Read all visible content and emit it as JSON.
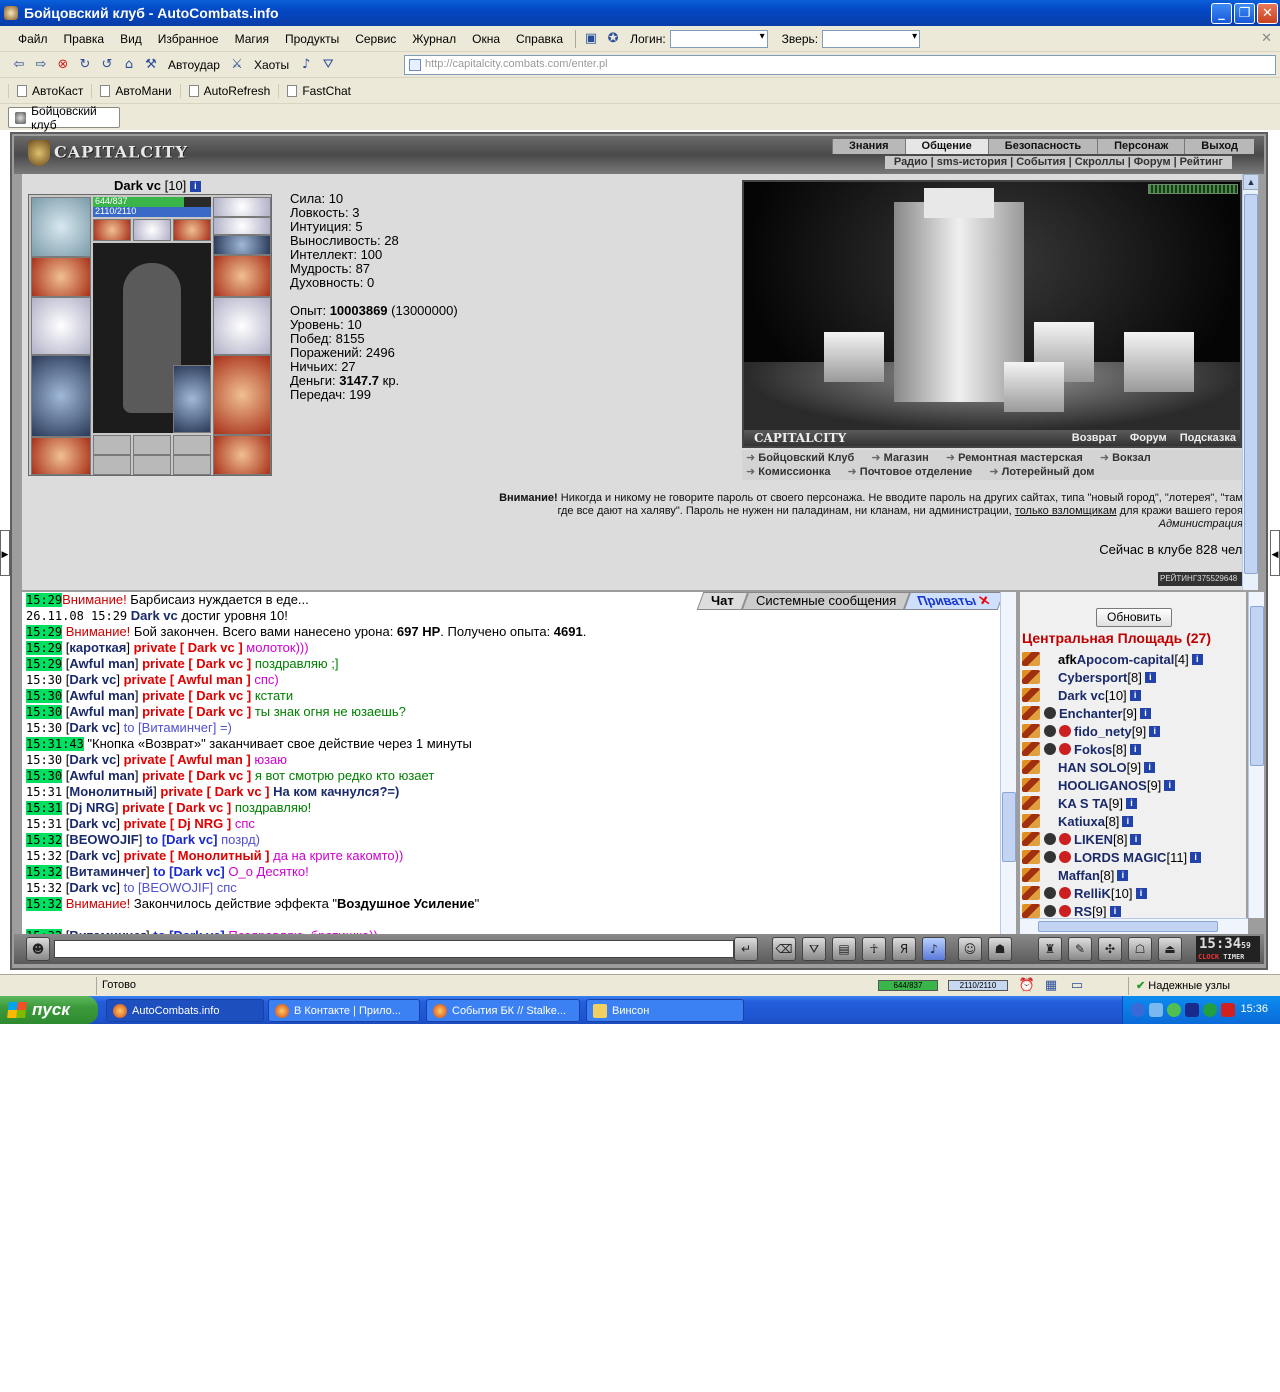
{
  "window": {
    "title": "Бойцовский клуб - AutoCombats.info",
    "min": "_",
    "max": "❐",
    "close": "✕"
  },
  "menu": {
    "items": [
      "Файл",
      "Правка",
      "Вид",
      "Избранное",
      "Магия",
      "Продукты",
      "Сервис",
      "Журнал",
      "Окна",
      "Справка"
    ],
    "login_label": "Логин:",
    "beast_label": "Зверь:",
    "login_value": "",
    "beast_value": ""
  },
  "nav": {
    "autoudar": "Автоудар",
    "haoty": "Хаоты",
    "url": "http://capitalcity.combats.com/enter.pl"
  },
  "favorites": [
    "АвтоКаст",
    "АвтоМани",
    "AutoRefresh",
    "FastChat"
  ],
  "tab": {
    "label": "Бойцовский клуб"
  },
  "game": {
    "logo": "CAPITALCITY",
    "top_nav": [
      "Знания",
      "Общение",
      "Безопасность",
      "Персонаж",
      "Выход"
    ],
    "top_nav_active": "Общение",
    "sub_nav": [
      "Радио",
      "sms-история",
      "События",
      "Скроллы",
      "Форум",
      "Рейтинг"
    ],
    "char": {
      "name": "Dark vc",
      "level": "[10]",
      "hp": "644/837",
      "hp_fraction": 0.77,
      "mp": "2110/2110",
      "mp_fraction": 1.0
    },
    "stats": [
      {
        "label": "Сила:",
        "value": "10"
      },
      {
        "label": "Ловкость:",
        "value": "3"
      },
      {
        "label": "Интуиция:",
        "value": "5"
      },
      {
        "label": "Выносливость:",
        "value": "28"
      },
      {
        "label": "Интеллект:",
        "value": "100"
      },
      {
        "label": "Мудрость:",
        "value": "87"
      },
      {
        "label": "Духовность:",
        "value": "0"
      }
    ],
    "exp_label": "Опыт:",
    "exp_value": "10003869",
    "exp_next": "(13000000)",
    "level_label": "Уровень:",
    "level_value": "10",
    "wins_label": "Побед:",
    "wins_value": "8155",
    "losses_label": "Поражений:",
    "losses_value": "2496",
    "draws_label": "Ничьих:",
    "draws_value": "27",
    "money_label": "Деньги:",
    "money_value": "3147.7",
    "money_unit": "кр.",
    "transfers_label": "Передач:",
    "transfers_value": "199",
    "city_name": "CAPITALCITY",
    "city_bar_links": [
      "Возврат",
      "Форум",
      "Подсказка"
    ],
    "city_links": [
      "Бойцовский Клуб",
      "Магазин",
      "Ремонтная мастерская",
      "Вокзал",
      "Комиссионка",
      "Почтовое отделение",
      "Лотерейный дом"
    ],
    "warning_bold": "Внимание!",
    "warning_text": "Никогда и никому не говорите пароль от своего персонажа. Не вводите пароль на других сайтах, типа \"новый город\", \"лотерея\", \"там, где все дают на халяву\". Пароль не нужен ни паладинам, ни кланам, ни администрации,",
    "warning_link": "только взломщикам",
    "warning_tail": "для кражи вашего героя.",
    "warning_sign": "Администрация.",
    "online": "Сейчас в клубе 828 чел.",
    "rating": "РЕЙТИНГ375529648"
  },
  "chat": {
    "tabs": [
      "Чат",
      "Системные сообщения",
      "Приваты"
    ],
    "lines": [
      {
        "t": "15:29",
        "g": true,
        "parts": [
          {
            "c": "sys",
            "x": "Внимание!"
          },
          {
            "c": "",
            "x": " Барбисаиз нуждается в еде..."
          }
        ]
      },
      {
        "t": "26.11.08 15:29",
        "g": false,
        "parts": [
          {
            "c": "nick",
            "x": " Dark vc"
          },
          {
            "c": "",
            "x": " достиг уровня 10!"
          }
        ]
      },
      {
        "t": "15:29",
        "g": true,
        "parts": [
          {
            "c": "sys",
            "x": " Внимание!"
          },
          {
            "c": "",
            "x": " Бой закончен. Всего вами нанесено урона: "
          },
          {
            "c": "b",
            "x": "697 HP"
          },
          {
            "c": "",
            "x": ". Получено опыта: "
          },
          {
            "c": "b",
            "x": "4691"
          },
          {
            "c": "",
            "x": "."
          }
        ]
      },
      {
        "t": "15:29",
        "g": true,
        "parts": [
          {
            "c": "",
            "x": " ["
          },
          {
            "c": "nick",
            "x": "кароткая"
          },
          {
            "c": "",
            "x": "] "
          },
          {
            "c": "priv",
            "x": "private [ Dark vc ]"
          },
          {
            "c": "msg-pink",
            "x": " молоток)))"
          }
        ]
      },
      {
        "t": "15:29",
        "g": true,
        "parts": [
          {
            "c": "",
            "x": " ["
          },
          {
            "c": "nick",
            "x": "Awful man"
          },
          {
            "c": "",
            "x": "] "
          },
          {
            "c": "priv",
            "x": "private [ Dark vc ]"
          },
          {
            "c": "msg-priv",
            "x": " поздравляю ;]"
          }
        ]
      },
      {
        "t": "15:30",
        "g": false,
        "parts": [
          {
            "c": "",
            "x": " ["
          },
          {
            "c": "nick",
            "x": "Dark vc"
          },
          {
            "c": "",
            "x": "] "
          },
          {
            "c": "priv",
            "x": "private [ Awful man ]"
          },
          {
            "c": "msg-pink",
            "x": " спс)"
          }
        ]
      },
      {
        "t": "15:30",
        "g": true,
        "parts": [
          {
            "c": "",
            "x": " ["
          },
          {
            "c": "nick",
            "x": "Awful man"
          },
          {
            "c": "",
            "x": "] "
          },
          {
            "c": "priv",
            "x": "private [ Dark vc ]"
          },
          {
            "c": "msg-priv",
            "x": " кстати"
          }
        ]
      },
      {
        "t": "15:30",
        "g": true,
        "parts": [
          {
            "c": "",
            "x": " ["
          },
          {
            "c": "nick",
            "x": "Awful man"
          },
          {
            "c": "",
            "x": "] "
          },
          {
            "c": "priv",
            "x": "private [ Dark vc ]"
          },
          {
            "c": "msg-priv",
            "x": " ты знак огня не юзаешь?"
          }
        ]
      },
      {
        "t": "15:30",
        "g": false,
        "parts": [
          {
            "c": "",
            "x": " ["
          },
          {
            "c": "nick",
            "x": "Dark vc"
          },
          {
            "c": "",
            "x": "] "
          },
          {
            "c": "to",
            "x": "to [Витаминчег] =)"
          }
        ]
      },
      {
        "t": "15:31:43",
        "g": true,
        "parts": [
          {
            "c": "",
            "x": " \"Кнопка «Возврат»\" заканчивает свое действие через 1 минуты"
          }
        ]
      },
      {
        "t": "15:30",
        "g": false,
        "parts": [
          {
            "c": "",
            "x": " ["
          },
          {
            "c": "nick",
            "x": "Dark vc"
          },
          {
            "c": "",
            "x": "] "
          },
          {
            "c": "priv",
            "x": "private [ Awful man ]"
          },
          {
            "c": "msg-pink",
            "x": " юзаю"
          }
        ]
      },
      {
        "t": "15:30",
        "g": true,
        "parts": [
          {
            "c": "",
            "x": " ["
          },
          {
            "c": "nick",
            "x": "Awful man"
          },
          {
            "c": "",
            "x": "] "
          },
          {
            "c": "priv",
            "x": "private [ Dark vc ]"
          },
          {
            "c": "msg-priv",
            "x": " я вот смотрю редко кто юзает"
          }
        ]
      },
      {
        "t": "15:31",
        "g": false,
        "parts": [
          {
            "c": "",
            "x": " ["
          },
          {
            "c": "nick",
            "x": "Монолитный"
          },
          {
            "c": "",
            "x": "] "
          },
          {
            "c": "priv",
            "x": "private [ Dark vc ]"
          },
          {
            "c": "nick",
            "x": " На ком качнулся?=)"
          }
        ]
      },
      {
        "t": "15:31",
        "g": true,
        "parts": [
          {
            "c": "",
            "x": " ["
          },
          {
            "c": "nick",
            "x": "Dj NRG"
          },
          {
            "c": "",
            "x": "] "
          },
          {
            "c": "priv",
            "x": "private [ Dark vc ]"
          },
          {
            "c": "msg-priv",
            "x": " поздравляю!"
          }
        ]
      },
      {
        "t": "15:31",
        "g": false,
        "parts": [
          {
            "c": "",
            "x": " ["
          },
          {
            "c": "nick",
            "x": "Dark vc"
          },
          {
            "c": "",
            "x": "] "
          },
          {
            "c": "priv",
            "x": "private [ Dj NRG ]"
          },
          {
            "c": "msg-pink",
            "x": " спс"
          }
        ]
      },
      {
        "t": "15:32",
        "g": true,
        "parts": [
          {
            "c": "",
            "x": " ["
          },
          {
            "c": "nick",
            "x": "BEOWOJIF"
          },
          {
            "c": "",
            "x": "] "
          },
          {
            "c": "to-b",
            "x": "to [Dark vc]"
          },
          {
            "c": "to",
            "x": " позрд)"
          }
        ]
      },
      {
        "t": "15:32",
        "g": false,
        "parts": [
          {
            "c": "",
            "x": " ["
          },
          {
            "c": "nick",
            "x": "Dark vc"
          },
          {
            "c": "",
            "x": "] "
          },
          {
            "c": "priv",
            "x": "private [ Монолитный ]"
          },
          {
            "c": "msg-pink",
            "x": " да на крите какомто))"
          }
        ]
      },
      {
        "t": "15:32",
        "g": true,
        "parts": [
          {
            "c": "",
            "x": " ["
          },
          {
            "c": "nick",
            "x": "Витаминчег"
          },
          {
            "c": "",
            "x": "] "
          },
          {
            "c": "to-b",
            "x": "to [Dark vc]"
          },
          {
            "c": "msg-pink",
            "x": " O_o Десятко!"
          }
        ]
      },
      {
        "t": "15:32",
        "g": false,
        "parts": [
          {
            "c": "",
            "x": " ["
          },
          {
            "c": "nick",
            "x": "Dark vc"
          },
          {
            "c": "",
            "x": "] "
          },
          {
            "c": "to",
            "x": "to [BEOWOJIF] спс"
          }
        ]
      },
      {
        "t": "15:32",
        "g": true,
        "parts": [
          {
            "c": "sys",
            "x": " Внимание!"
          },
          {
            "c": "",
            "x": " Закончилось действие эффекта \""
          },
          {
            "c": "b",
            "x": "Воздушное Усиление"
          },
          {
            "c": "",
            "x": "\""
          }
        ]
      },
      {
        "t": "",
        "g": false,
        "parts": [
          {
            "c": "",
            "x": " "
          }
        ]
      },
      {
        "t": "15:32",
        "g": true,
        "parts": [
          {
            "c": "",
            "x": " ["
          },
          {
            "c": "nick",
            "x": "Витаминчег"
          },
          {
            "c": "",
            "x": "] "
          },
          {
            "c": "to-b",
            "x": "to [Dark vc]"
          },
          {
            "c": "msg-pink",
            "x": "        Поздравляю, братишка))"
          }
        ]
      }
    ]
  },
  "users": {
    "refresh": "Обновить",
    "room": "Центральная Площадь (27)",
    "list": [
      {
        "prefix": "afk ",
        "name": "Apocom-capital",
        "lvl": "[4]",
        "clan": 0
      },
      {
        "prefix": "",
        "name": "Cybersport",
        "lvl": "[8]",
        "clan": 0
      },
      {
        "prefix": "",
        "name": "Dark vc",
        "lvl": "[10]",
        "clan": 0
      },
      {
        "prefix": "",
        "name": "Enchanter",
        "lvl": "[9]",
        "clan": 1
      },
      {
        "prefix": "",
        "name": "fido_nety",
        "lvl": "[9]",
        "clan": 2
      },
      {
        "prefix": "",
        "name": "Fokos",
        "lvl": "[8]",
        "clan": 2
      },
      {
        "prefix": "",
        "name": "HAN SOLO",
        "lvl": "[9]",
        "clan": 0
      },
      {
        "prefix": "",
        "name": "HOOLIGANOS",
        "lvl": "[9]",
        "clan": 0
      },
      {
        "prefix": "",
        "name": "KA S TA",
        "lvl": "[9]",
        "clan": 0
      },
      {
        "prefix": "",
        "name": "Katiuxa",
        "lvl": "[8]",
        "clan": 0
      },
      {
        "prefix": "",
        "name": "LIKEN",
        "lvl": "[8]",
        "clan": 2
      },
      {
        "prefix": "",
        "name": "LORDS MAGIC",
        "lvl": "[11]",
        "clan": 2
      },
      {
        "prefix": "",
        "name": "Maffan",
        "lvl": "[8]",
        "clan": 0
      },
      {
        "prefix": "",
        "name": "RelliK",
        "lvl": "[10]",
        "clan": 2
      },
      {
        "prefix": "",
        "name": "RS",
        "lvl": "[9]",
        "clan": 2
      }
    ]
  },
  "clock": {
    "time": "15:34",
    "sec": "59",
    "clock_tag": "CLOCK",
    "timer_tag": "TIMER"
  },
  "status": {
    "ready": "Готово",
    "hp": "644/837",
    "mp": "2110/2110",
    "nodes": "Надежные узлы"
  },
  "taskbar": {
    "start": "пуск",
    "tasks": [
      "AutoCombats.info",
      "В Контакте | Прило...",
      "События БК // Stalke...",
      "Винсон"
    ],
    "time": "15:36"
  }
}
